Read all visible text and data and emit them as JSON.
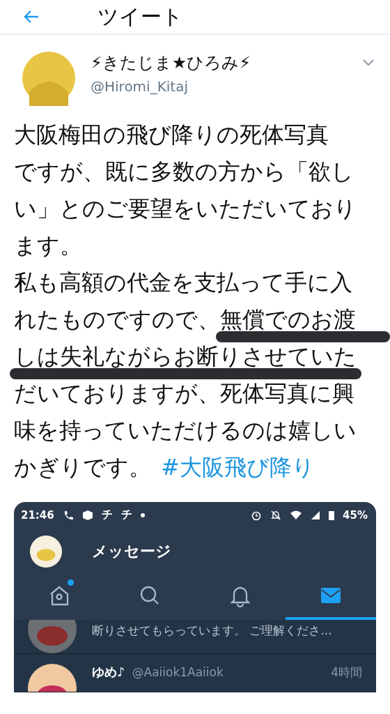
{
  "header": {
    "title": "ツイート"
  },
  "tweet": {
    "display_name": "⚡きたじま★ひろみ⚡",
    "handle": "@Hiromi_Kitaj",
    "lines": [
      "大阪梅田の飛び降りの死体写真",
      "ですが、既に多数の方から「欲し",
      "い」とのご要望をいただいており",
      "ます。",
      "私も高額の代金を支払って手に入",
      "れたものですので、無償でのお渡",
      "しは失礼ながらお断りさせていた",
      "だいておりますが、死体写真に興",
      "味を持っていただけるのは嬉しい",
      "かぎりです。"
    ],
    "hashtag": "#大阪飛び降り"
  },
  "embedded_screenshot": {
    "status_bar": {
      "time": "21:46",
      "notification_glyphs": [
        "チ",
        "チ"
      ],
      "battery": "45%"
    },
    "title": "メッセージ",
    "tabs": [
      {
        "kind": "home",
        "selected": false,
        "badge": true
      },
      {
        "kind": "search",
        "selected": false,
        "badge": false
      },
      {
        "kind": "bell",
        "selected": false,
        "badge": false
      },
      {
        "kind": "mail",
        "selected": true,
        "badge": false
      }
    ],
    "messages": [
      {
        "preview": "断りさせてもらっています。 ご理解くださ..."
      },
      {
        "name": "ゆめ♪",
        "handle": "@Aaiiok1Aaiiok",
        "time": "4時間"
      }
    ]
  }
}
